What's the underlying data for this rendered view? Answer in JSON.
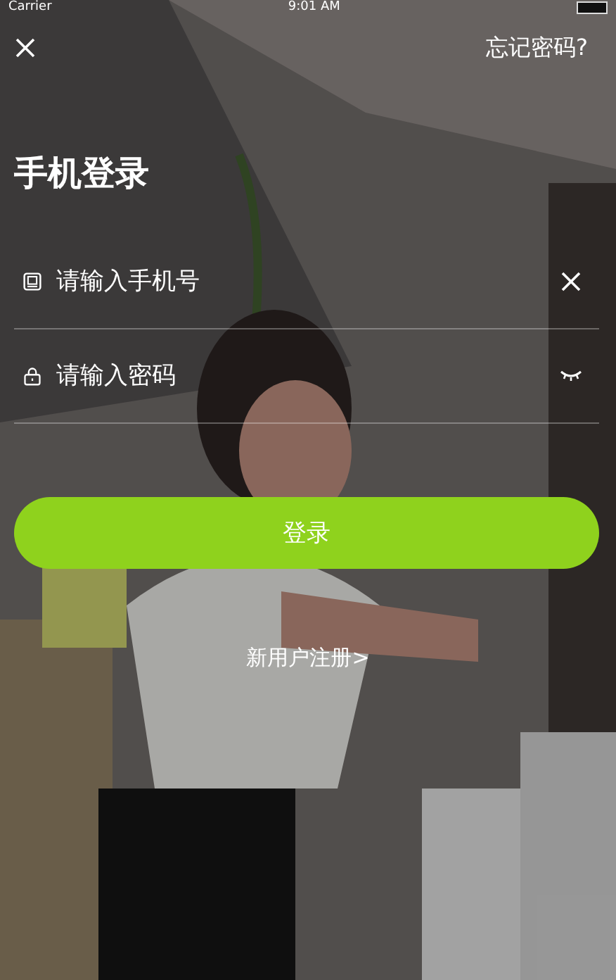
{
  "status_bar": {
    "carrier": "Carrier",
    "time": "9:01 AM"
  },
  "forgot_password": "忘记密码?",
  "title": "手机登录",
  "fields": [
    {
      "kind": "phone",
      "placeholder": "请输入手机号"
    },
    {
      "kind": "password",
      "placeholder": "请输入密码"
    }
  ],
  "login_button": "登录",
  "register_link": "新用户注册>"
}
